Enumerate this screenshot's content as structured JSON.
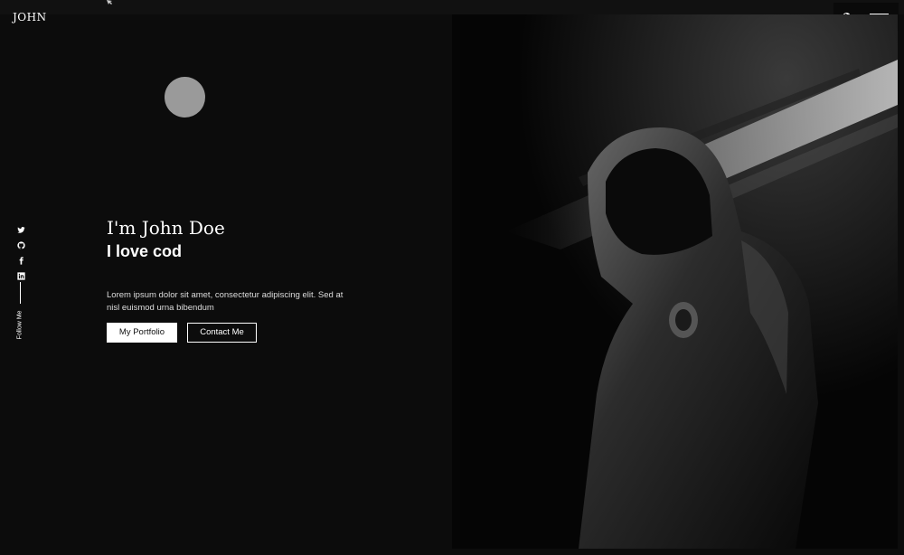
{
  "header": {
    "logo": "JOHN"
  },
  "hero": {
    "greeting": "I'm John Doe",
    "tagline": "I love cod",
    "description": "Lorem ipsum dolor sit amet, consectetur adipiscing elit. Sed at nisl euismod urna bibendum",
    "primary_button": "My Portfolio",
    "secondary_button": "Contact Me"
  },
  "social": {
    "follow_label": "Follow Me",
    "icons": [
      "twitter-icon",
      "github-icon",
      "facebook-icon",
      "linkedin-icon"
    ]
  },
  "colors": {
    "background": "#0c0c0c",
    "text": "#ffffff",
    "avatar": "#9a9a9a"
  }
}
